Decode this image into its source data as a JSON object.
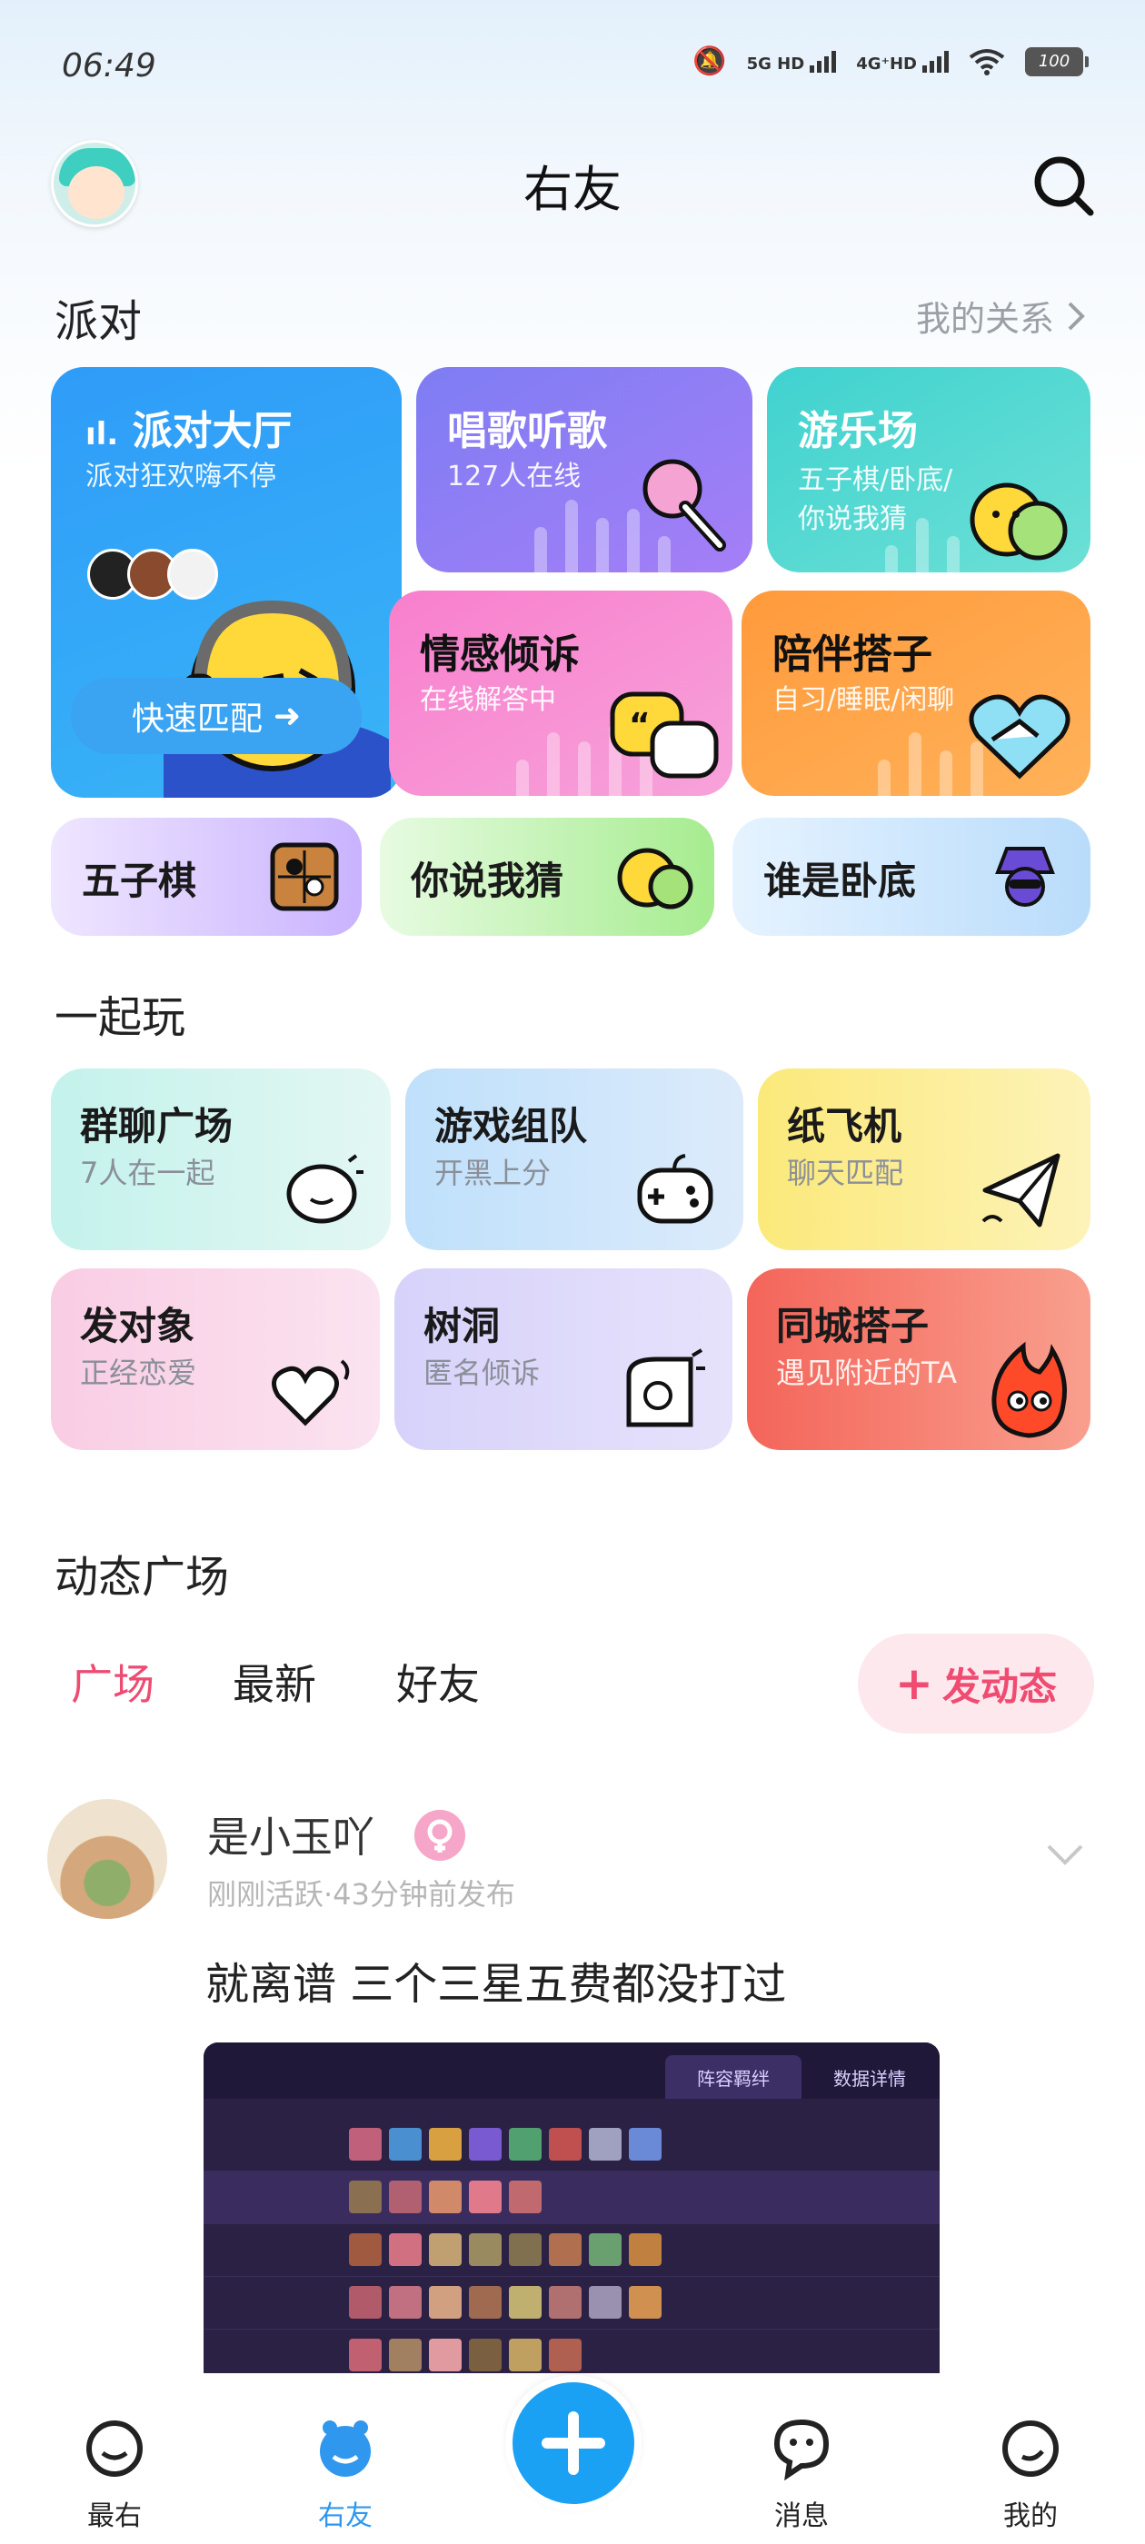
{
  "status_bar": {
    "time": "06:49",
    "net1": "5G HD",
    "net2": "4G⁺HD",
    "battery": "100"
  },
  "header": {
    "title": "右友"
  },
  "party": {
    "title": "派对",
    "link": "我的关系",
    "hall": {
      "title": "派对大厅",
      "subtitle": "派对狂欢嗨不停",
      "button": "快速匹配"
    },
    "sing": {
      "title": "唱歌听歌",
      "subtitle": "127人在线"
    },
    "playground": {
      "title": "游乐场",
      "subtitle_line1": "五子棋/卧底/",
      "subtitle_line2": "你说我猜"
    },
    "emotion": {
      "title": "情感倾诉",
      "subtitle": "在线解答中"
    },
    "companion": {
      "title": "陪伴搭子",
      "subtitle": "自习/睡眠/闲聊"
    },
    "gomoku": {
      "title": "五子棋"
    },
    "guess": {
      "title": "你说我猜"
    },
    "spy": {
      "title": "谁是卧底"
    }
  },
  "play_together": {
    "title": "一起玩",
    "items": [
      {
        "title": "群聊广场",
        "subtitle": "7人在一起"
      },
      {
        "title": "游戏组队",
        "subtitle": "开黑上分"
      },
      {
        "title": "纸飞机",
        "subtitle": "聊天匹配"
      },
      {
        "title": "发对象",
        "subtitle": "正经恋爱"
      },
      {
        "title": "树洞",
        "subtitle": "匿名倾诉"
      },
      {
        "title": "同城搭子",
        "subtitle": "遇见附近的TA"
      }
    ]
  },
  "feed": {
    "title": "动态广场",
    "tabs": [
      "广场",
      "最新",
      "好友"
    ],
    "post_button": "发动态"
  },
  "post": {
    "author": "是小玉吖",
    "meta": "刚刚活跃·43分钟前发布",
    "text": "就离谱 三个三星五费都没打过",
    "image_tabs": [
      "阵容羁绊",
      "数据详情"
    ]
  },
  "bottom_nav": {
    "items": [
      "最右",
      "右友",
      "消息",
      "我的"
    ]
  },
  "colors": {
    "accent_blue": "#1aa1f4",
    "accent_pink": "#ef4a72"
  }
}
